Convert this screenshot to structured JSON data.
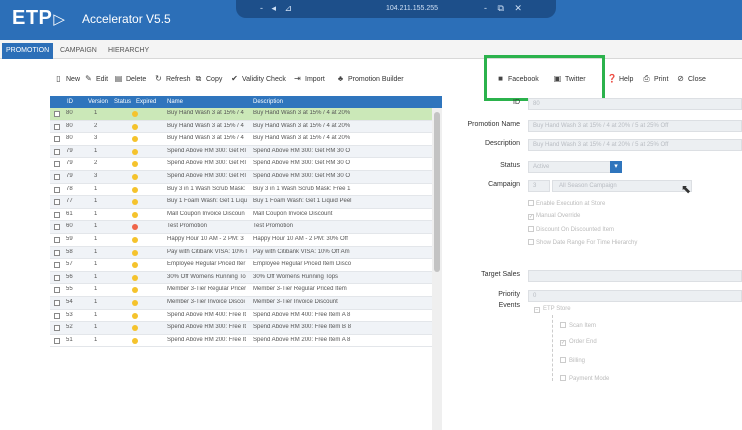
{
  "titlebar": {
    "brand": "ETP",
    "brand_arrow": "▷",
    "app_name": "Accelerator V5.5",
    "remote_ip": "104.211.155.255",
    "remote_left_controls": "- ◂ ⊿",
    "remote_right_controls": "- ⧉ ✕"
  },
  "tabs": [
    {
      "label": "PROMOTION",
      "active": true
    },
    {
      "label": "CAMPAIGN",
      "active": false
    },
    {
      "label": "HIERARCHY",
      "active": false
    }
  ],
  "toolbar": {
    "new": "New",
    "edit": "Edit",
    "delete": "Delete",
    "refresh": "Refresh",
    "copy": "Copy",
    "validity_check": "Validity Check",
    "import": "Import",
    "promotion_builder": "Promotion Builder",
    "facebook": "Facebook",
    "twitter": "Twitter",
    "help": "Help",
    "print": "Print",
    "close": "Close"
  },
  "icons": {
    "new": "document-icon",
    "edit": "pencil-icon",
    "delete": "trash-icon",
    "refresh": "refresh-icon",
    "copy": "copy-icon",
    "validity_check": "check-circle-icon",
    "import": "import-icon",
    "promotion_builder": "builder-icon",
    "facebook": "facebook-icon",
    "twitter": "twitter-icon",
    "help": "help-icon",
    "print": "printer-icon",
    "close": "close-icon"
  },
  "grid": {
    "columns": [
      "ID",
      "Version",
      "Status",
      "Expired",
      "Name",
      "Description"
    ],
    "rows": [
      {
        "id": "80",
        "version": "1",
        "status": "yellow",
        "name": "Buy Hand Wash 3 at 15% / 4",
        "description": "Buy Hand Wash 3 at 15% / 4 at 20%",
        "selected": true
      },
      {
        "id": "80",
        "version": "2",
        "status": "yellow",
        "name": "Buy Hand Wash 3 at 15% / 4",
        "description": "Buy Hand Wash 3 at 15% / 4 at 20%",
        "selected": false
      },
      {
        "id": "80",
        "version": "3",
        "status": "yellow",
        "name": "Buy Hand Wash 3 at 15% / 4",
        "description": "Buy Hand Wash 3 at 15% / 4 at 20%",
        "selected": false
      },
      {
        "id": "79",
        "version": "1",
        "status": "yellow",
        "name": "Spend Above RM 300: Get RI",
        "description": "Spend Above RM 300: Get RM 30 O",
        "selected": false
      },
      {
        "id": "79",
        "version": "2",
        "status": "yellow",
        "name": "Spend Above RM 300: Get RI",
        "description": "Spend Above RM 300: Get RM 30 O",
        "selected": false
      },
      {
        "id": "79",
        "version": "3",
        "status": "yellow",
        "name": "Spend Above RM 300: Get RI",
        "description": "Spend Above RM 300: Get RM 30 O",
        "selected": false
      },
      {
        "id": "78",
        "version": "1",
        "status": "yellow",
        "name": "Buy 3 in 1 Wash Scrub Mask:",
        "description": "Buy 3 in 1 Wash Scrub Mask: Free 1",
        "selected": false
      },
      {
        "id": "77",
        "version": "1",
        "status": "yellow",
        "name": "Buy 1 Foam Wash: Get 1 Liqu",
        "description": "Buy 1 Foam Wash: Get 1 Liquid Peel",
        "selected": false
      },
      {
        "id": "61",
        "version": "1",
        "status": "yellow",
        "name": "Mall Coupon Invoice Discoun",
        "description": "Mall Coupon Invoice Discount",
        "selected": false
      },
      {
        "id": "60",
        "version": "1",
        "status": "red",
        "name": "Test Promotion",
        "description": "Test Promotion",
        "selected": false
      },
      {
        "id": "59",
        "version": "1",
        "status": "yellow",
        "name": "Happy Hour 10 AM - 2 PM: 3",
        "description": "Happy Hour 10 AM - 2 PM: 30% Off",
        "selected": false
      },
      {
        "id": "58",
        "version": "1",
        "status": "yellow",
        "name": "Pay with Citibank VISA: 10% I",
        "description": "Pay with Citibank VISA: 10% Off Am",
        "selected": false
      },
      {
        "id": "57",
        "version": "1",
        "status": "yellow",
        "name": "Employee Regular Priced Iter",
        "description": "Employee Regular Priced Item Disco",
        "selected": false
      },
      {
        "id": "56",
        "version": "1",
        "status": "yellow",
        "name": "30% Off Womens Running To",
        "description": "30% Off Womens Running Tops",
        "selected": false
      },
      {
        "id": "55",
        "version": "1",
        "status": "yellow",
        "name": "Member 3-Tier Regular Pricer",
        "description": "Member 3-Tier Regular Priced Item",
        "selected": false
      },
      {
        "id": "54",
        "version": "1",
        "status": "yellow",
        "name": "Member 3-Tier Invoice Discoi",
        "description": "Member 3-Tier Invoice Discount",
        "selected": false
      },
      {
        "id": "53",
        "version": "1",
        "status": "yellow",
        "name": "Spend Above RM 400: Free It",
        "description": "Spend Above RM 400: Free Item A 8",
        "selected": false
      },
      {
        "id": "52",
        "version": "1",
        "status": "yellow",
        "name": "Spend Above RM 300: Free It",
        "description": "Spend Above RM 300: Free Item B 8",
        "selected": false
      },
      {
        "id": "51",
        "version": "1",
        "status": "yellow",
        "name": "Spend Above RM 200: Free It",
        "description": "Spend Above RM 200: Free Item A 8",
        "selected": false
      }
    ]
  },
  "form": {
    "id_label": "ID",
    "id_value": "80",
    "promotion_name_label": "Promotion Name",
    "promotion_name_value": "Buy Hand Wash 3 at 15% / 4 at 20% / 5 at 25% Off",
    "description_label": "Description",
    "description_value": "Buy Hand Wash 3 at 15% / 4 at 20% / 5 at 25% Off",
    "status_label": "Status",
    "status_value": "Active",
    "campaign_label": "Campaign",
    "campaign_number": "3",
    "campaign_value": "All Season Campaign",
    "checkboxes": [
      {
        "label": "Enable Execution at Store",
        "checked": false
      },
      {
        "label": "Manual Override",
        "checked": true
      },
      {
        "label": "Discount On Discounted Item",
        "checked": false
      },
      {
        "label": "Show Date Range For Time Hierarchy",
        "checked": false
      }
    ],
    "target_sales_label": "Target Sales",
    "priority_label": "Priority",
    "priority_value": "0",
    "events_label": "Events",
    "events_root": "ETP Store",
    "events_children": [
      {
        "label": "Scan Item",
        "checked": false
      },
      {
        "label": "Order End",
        "checked": true
      },
      {
        "label": "Billing",
        "checked": false
      },
      {
        "label": "Payment Mode",
        "checked": false
      }
    ]
  },
  "colors": {
    "titlebar": "#2c6fb8",
    "grid_header": "#2f75bd",
    "selected_row": "#cbe8b8",
    "status_yellow": "#f5c32c",
    "status_red": "#f0654a",
    "highlight_box": "#2bb24c"
  }
}
